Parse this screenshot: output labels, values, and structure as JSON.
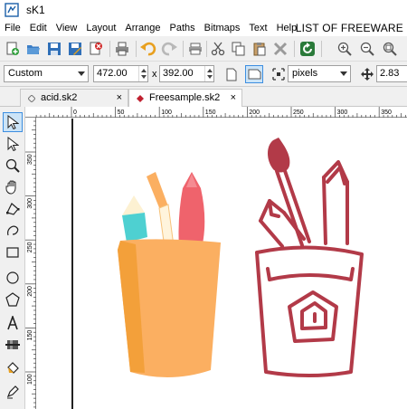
{
  "window": {
    "title": "sK1"
  },
  "menu": {
    "items": [
      "File",
      "Edit",
      "View",
      "Layout",
      "Arrange",
      "Paths",
      "Bitmaps",
      "Text",
      "Help"
    ],
    "watermark": "LIST OF FREEWARE"
  },
  "toolbar": {
    "icons": [
      "new-icon",
      "open-icon",
      "save-icon",
      "save-as-icon",
      "close-document-icon",
      "print-icon",
      "undo-icon",
      "redo-icon",
      "cut-icon",
      "copy-icon",
      "paste-icon",
      "delete-icon",
      "refresh-icon",
      "zoom-in-icon",
      "zoom-out-icon",
      "zoom-fit-icon"
    ]
  },
  "propbar": {
    "page_format": "Custom",
    "width": "472.00",
    "times_label": "x",
    "height": "392.00",
    "units": "pixels",
    "units_icon": "units-icon",
    "nudge": "2.83"
  },
  "tabs": [
    {
      "label": "acid.sk2",
      "active": false,
      "close": "×"
    },
    {
      "label": "Freesample.sk2",
      "active": true,
      "close": "×"
    }
  ],
  "hruler": {
    "ticks": [
      "0",
      "50",
      "100",
      "150",
      "200",
      "250",
      "300",
      "350"
    ]
  },
  "vruler": {
    "ticks": [
      "350",
      "300",
      "250",
      "200",
      "150",
      "100"
    ]
  },
  "tools": [
    "select-icon",
    "node-edit-icon",
    "zoom-icon",
    "fleur-icon",
    "curve-icon",
    "bezier-icon",
    "rectangle-icon",
    "ellipse-icon",
    "polygon-icon",
    "text-icon",
    "gradient-icon",
    "fill-icon",
    "outline-icon"
  ],
  "colors": {
    "accent": "#3d8ee0",
    "cup_orange": "#fbaf61",
    "cup_shadow": "#f3a03a",
    "pencil_teal": "#4ed0d1",
    "pencil_red": "#ef636c",
    "outline_red": "#b23a48"
  }
}
